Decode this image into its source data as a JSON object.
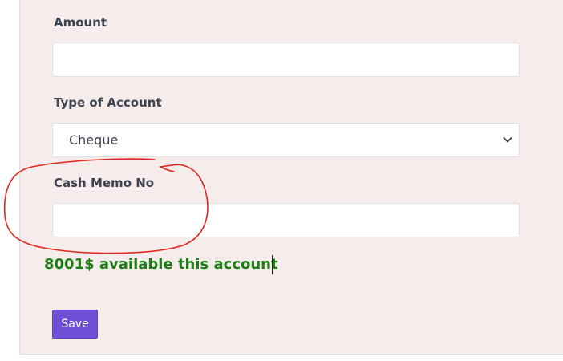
{
  "form": {
    "amount": {
      "label": "Amount",
      "value": ""
    },
    "account_type": {
      "label": "Type of Account",
      "selected": "Cheque"
    },
    "cash_memo": {
      "label": "Cash Memo No",
      "value": ""
    },
    "balance_message": "8001$ available this account",
    "save_label": "Save"
  },
  "colors": {
    "card_background": "#f7ecec",
    "balance_text": "#1b7d14",
    "save_button": "#6f4fd6",
    "annotation_circle": "#e0271b"
  },
  "icons": {
    "select_arrow": "chevron-down-icon"
  }
}
